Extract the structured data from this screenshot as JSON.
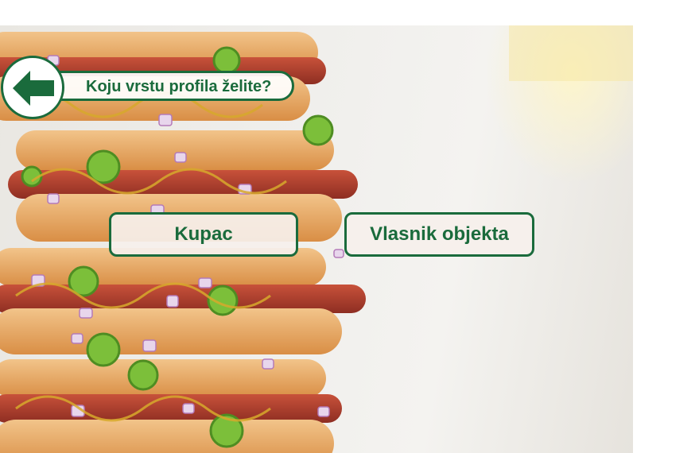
{
  "header": {
    "title": "Koju vrstu profila želite?"
  },
  "icons": {
    "back": "arrow-left-icon"
  },
  "choices": {
    "customer_label": "Kupac",
    "owner_label": "Vlasnik objekta"
  },
  "colors": {
    "accent": "#1a6b3c",
    "button_fill": "#f6f0ec",
    "background": "#ffffff"
  }
}
